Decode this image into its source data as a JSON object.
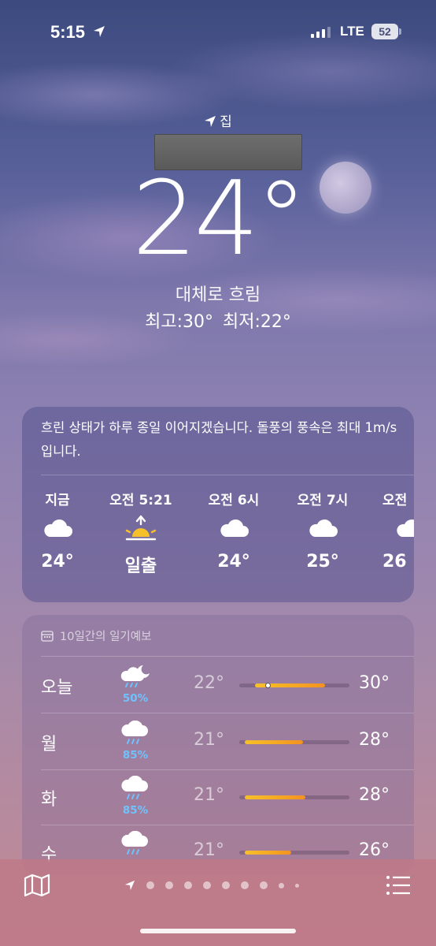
{
  "status_bar": {
    "time": "5:15",
    "network": "LTE",
    "battery": "52"
  },
  "header": {
    "location_label": "집",
    "temperature": "24°",
    "condition": "대체로 흐림",
    "high": "최고:30°",
    "low": "최저:22°"
  },
  "hourly": {
    "summary": "흐린 상태가 하루 종일 이어지겠습니다. 돌풍의 풍속은 최대 1m/s입니다.",
    "items": [
      {
        "label": "지금",
        "icon": "cloud-icon",
        "value": "24°"
      },
      {
        "label": "오전 5:21",
        "icon": "sunrise-icon",
        "value": "일출"
      },
      {
        "label": "오전 6시",
        "icon": "cloud-icon",
        "value": "24°"
      },
      {
        "label": "오전 7시",
        "icon": "cloud-icon",
        "value": "25°"
      },
      {
        "label": "오전",
        "icon": "cloud-icon",
        "value": "26"
      }
    ]
  },
  "forecast": {
    "title": "10일간의 일기예보",
    "days": [
      {
        "day": "오늘",
        "icon": "moon-cloud-rain-icon",
        "precip": "50%",
        "low": "22°",
        "high": "30°",
        "bar_start": 0.14,
        "bar_end": 0.78,
        "current": 0.26
      },
      {
        "day": "월",
        "icon": "cloud-rain-icon",
        "precip": "85%",
        "low": "21°",
        "high": "28°",
        "bar_start": 0.05,
        "bar_end": 0.58
      },
      {
        "day": "화",
        "icon": "cloud-rain-icon",
        "precip": "85%",
        "low": "21°",
        "high": "28°",
        "bar_start": 0.05,
        "bar_end": 0.6
      },
      {
        "day": "수",
        "icon": "cloud-rain-icon",
        "precip": "",
        "low": "21°",
        "high": "26°",
        "bar_start": 0.05,
        "bar_end": 0.47
      }
    ]
  },
  "toolbar": {
    "map_icon": "map-icon",
    "list_icon": "list-icon"
  },
  "colors": {
    "precip_blue": "#6ec3ff",
    "range_orange": "#f5a623"
  }
}
